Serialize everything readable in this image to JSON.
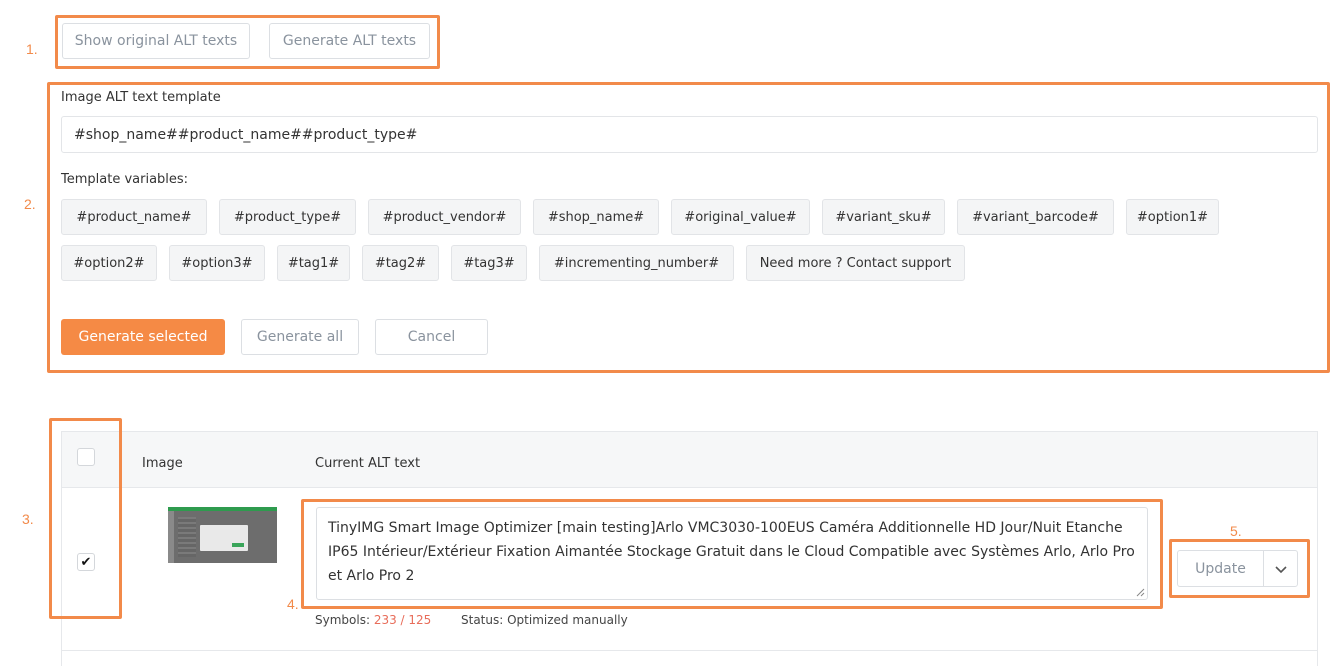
{
  "annotations": {
    "step1": "1.",
    "step2": "2.",
    "step3": "3.",
    "step4": "4.",
    "step5": "5.",
    "accent_color": "#f28a4a"
  },
  "top_buttons": {
    "show_original": "Show original ALT texts",
    "generate_alt": "Generate ALT texts"
  },
  "template_section": {
    "label": "Image ALT text template",
    "value": "#shop_name##product_name##product_type#",
    "variables_label": "Template variables:",
    "variables": [
      "#product_name#",
      "#product_type#",
      "#product_vendor#",
      "#shop_name#",
      "#original_value#",
      "#variant_sku#",
      "#variant_barcode#",
      "#option1#",
      "#option2#",
      "#option3#",
      "#tag1#",
      "#tag2#",
      "#tag3#",
      "#incrementing_number#",
      "Need more ? Contact support"
    ],
    "generate_selected": "Generate selected",
    "generate_all": "Generate all",
    "cancel": "Cancel"
  },
  "table": {
    "headers": {
      "image": "Image",
      "current_alt": "Current ALT text"
    },
    "header_checked": false,
    "rows": [
      {
        "checked": true,
        "check_glyph": "✔",
        "alt_text": "TinyIMG Smart Image Optimizer [main testing]Arlo VMC3030-100EUS Caméra Additionnelle HD Jour/Nuit Etanche IP65 Intérieur/Extérieur Fixation Aimantée Stockage Gratuit dans le Cloud Compatible avec Systèmes Arlo, Arlo Pro et Arlo Pro 2",
        "symbols_label": "Symbols:",
        "symbols_value": "233 / 125",
        "status_label": "Status: Optimized manually",
        "update_label": "Update"
      }
    ]
  }
}
